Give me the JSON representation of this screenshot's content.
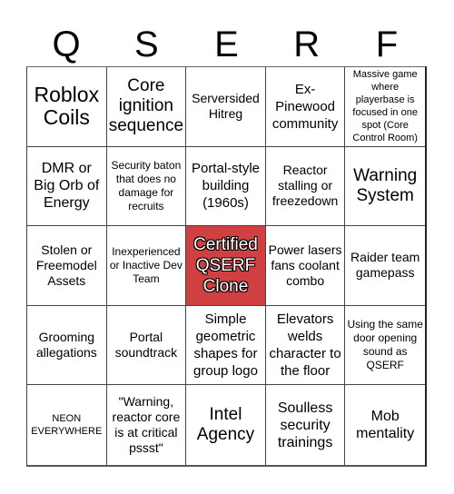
{
  "card": {
    "header": [
      "Q",
      "S",
      "E",
      "R",
      "F"
    ],
    "free_color": "#d04040",
    "cells": [
      "Roblox Coils",
      "Core ignition sequence",
      "Serversided Hitreg",
      "Ex-Pinewood community",
      "Massive game where playerbase is focused in one spot (Core Control Room)",
      "DMR or Big Orb of Energy",
      "Security baton that does no damage for recruits",
      "Portal-style building (1960s)",
      "Reactor stalling or freezedown",
      "Warning System",
      "Stolen or Freemodel Assets",
      "Inexperienced or Inactive Dev Team",
      "Certified QSERF Clone",
      "Power lasers fans coolant combo",
      "Raider team gamepass",
      "Grooming allegations",
      "Portal soundtrack",
      "Simple geometric shapes for group logo",
      "Elevators welds character to the floor",
      "Using the same door opening sound as QSERF",
      "NEON EVERYWHERE",
      "\"Warning, reactor core is at critical pssst\"",
      "Intel Agency",
      "Soulless security trainings",
      "Mob mentality"
    ]
  }
}
